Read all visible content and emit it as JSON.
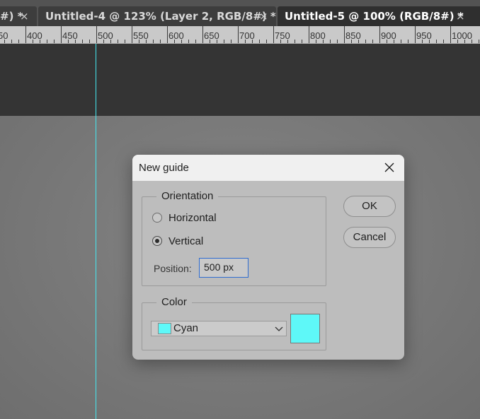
{
  "tabs": [
    {
      "label": "#) *",
      "close": "×"
    },
    {
      "label": "Untitled-4 @ 123% (Layer 2, RGB/8#) *",
      "close": "×"
    },
    {
      "label": "Untitled-5 @ 100% (RGB/8#) *",
      "close": "×"
    }
  ],
  "ruler": {
    "labels": [
      "50",
      "400",
      "450",
      "500",
      "550",
      "600",
      "650",
      "700",
      "750",
      "800",
      "850",
      "900",
      "950",
      "1000"
    ]
  },
  "dialog": {
    "title": "New guide",
    "orientation": {
      "legend": "Orientation",
      "horizontal_label": "Horizontal",
      "vertical_label": "Vertical",
      "selected": "Vertical"
    },
    "position": {
      "label": "Position:",
      "value": "500 px"
    },
    "color": {
      "legend": "Color",
      "selected": "Cyan",
      "swatch_hex": "#5ef8f8"
    },
    "ok_label": "OK",
    "cancel_label": "Cancel"
  },
  "colors": {
    "guide": "#45e8f0",
    "input_focus": "#2f6cd0"
  }
}
